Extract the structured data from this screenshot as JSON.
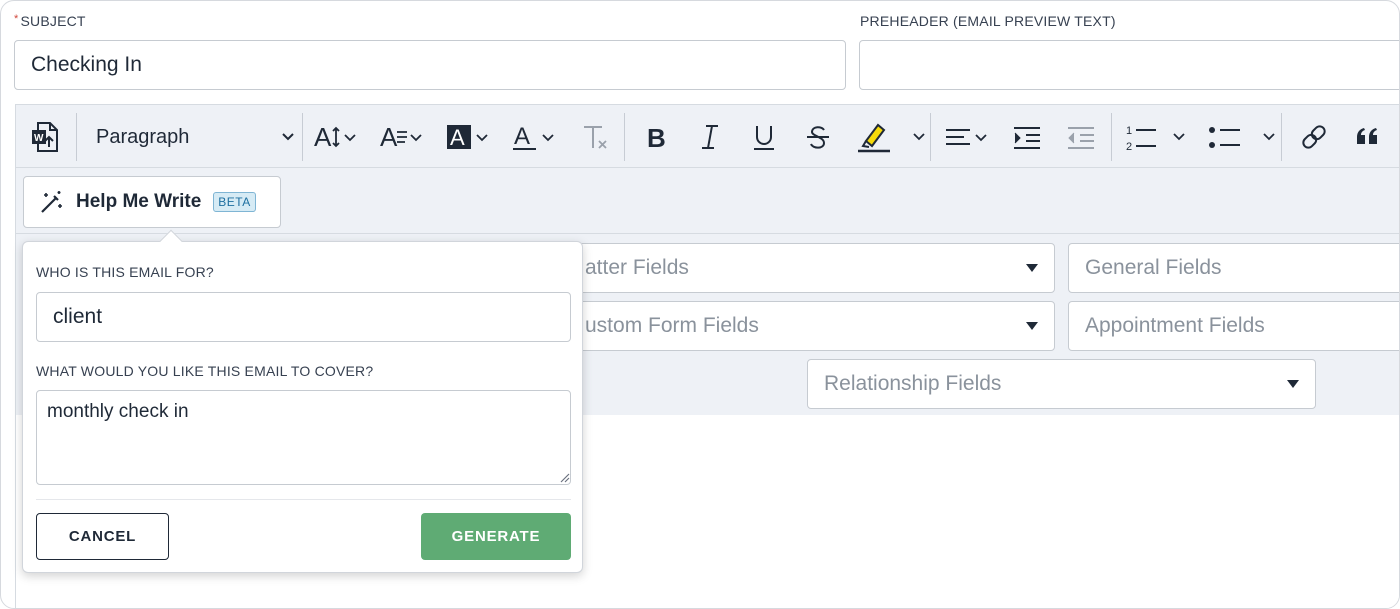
{
  "form": {
    "subject_label": "SUBJECT",
    "subject_required_mark": "*",
    "subject_value": "Checking In",
    "preheader_label": "PREHEADER (EMAIL PREVIEW TEXT)",
    "preheader_value": ""
  },
  "toolbar": {
    "block_format": "Paragraph",
    "icons": [
      "word-import-icon",
      "font-size-icon",
      "line-height-icon",
      "highlight-text-icon",
      "font-color-icon",
      "clear-formatting-icon",
      "bold-icon",
      "italic-icon",
      "underline-icon",
      "strikethrough-icon",
      "highlighter-icon",
      "align-left-icon",
      "indent-icon",
      "outdent-icon",
      "numbered-list-icon",
      "bulleted-list-icon",
      "link-icon",
      "quote-icon"
    ]
  },
  "help_me_write": {
    "label": "Help Me Write",
    "badge": "BETA"
  },
  "merge_fields": {
    "matter": "atter Fields",
    "general": "General Fields",
    "custom_form": "ustom Form Fields",
    "appointment": "Appointment Fields",
    "relationship": "Relationship Fields"
  },
  "popover": {
    "who_label": "WHO IS THIS EMAIL FOR?",
    "who_value": "client",
    "cover_label": "WHAT WOULD YOU LIKE THIS EMAIL TO COVER?",
    "cover_value": "monthly check in",
    "cancel_label": "CANCEL",
    "generate_label": "GENERATE"
  },
  "colors": {
    "generate_button": "#5fab74",
    "toolbar_bg": "#eef1f6",
    "beta_badge": "#1d6fa0",
    "required_mark": "#d0463b"
  }
}
